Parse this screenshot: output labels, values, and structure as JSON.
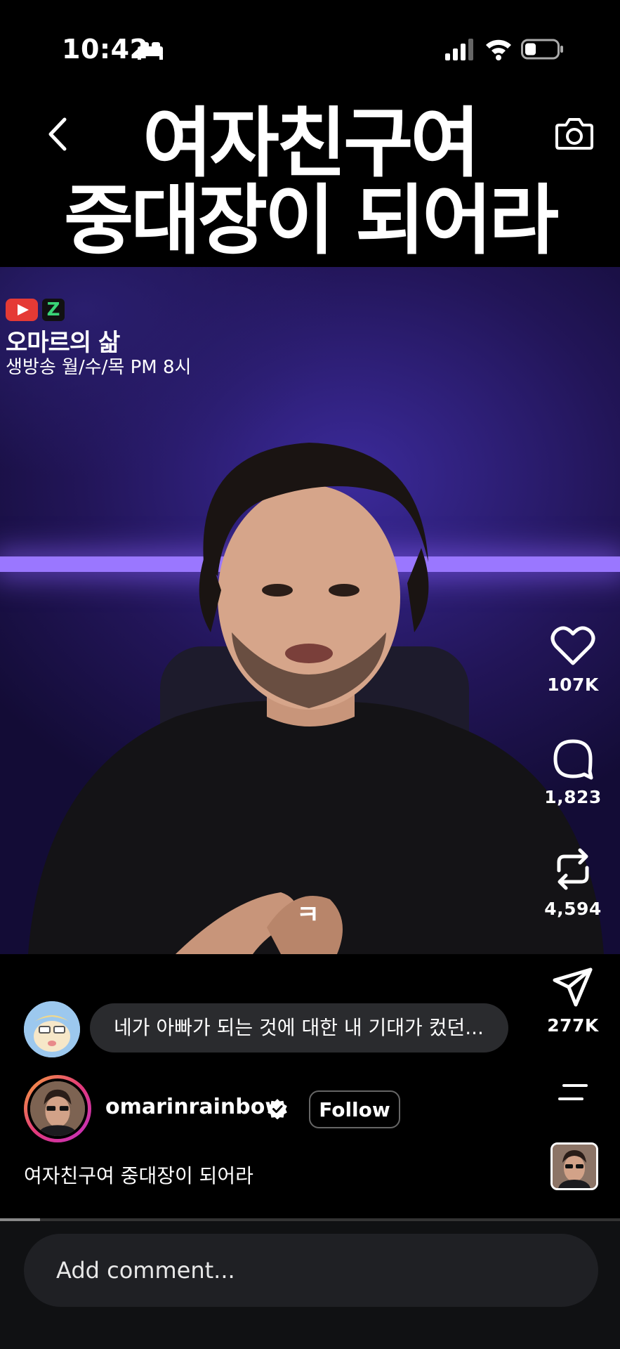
{
  "status_bar": {
    "time": "10:42",
    "signal_bars": 3,
    "battery_level": 0.35
  },
  "header": {
    "title_line1": "여자친구여",
    "title_line2": "중대장이 되어라"
  },
  "video": {
    "channel_name": "오마르의 삶",
    "channel_schedule": "생방송 월/수/목 PM 8시",
    "subtitle": "ㅋ"
  },
  "actions": {
    "likes": "107K",
    "comments": "1,823",
    "reposts": "4,594",
    "shares": "277K"
  },
  "comment_preview": {
    "text": "네가 아빠가 되는 것에 대한 내 기대가 컸던..."
  },
  "author": {
    "username": "omarinrainbow",
    "follow_label": "Follow"
  },
  "caption": "여자친구여 중대장이 되어라",
  "playback": {
    "progress": 0.065
  },
  "comment_input": {
    "placeholder": "Add comment..."
  },
  "colors": {
    "accent_gradient": [
      "#f7a23b",
      "#e33a7a",
      "#c12ec4"
    ],
    "neon": "#9a77ff"
  }
}
